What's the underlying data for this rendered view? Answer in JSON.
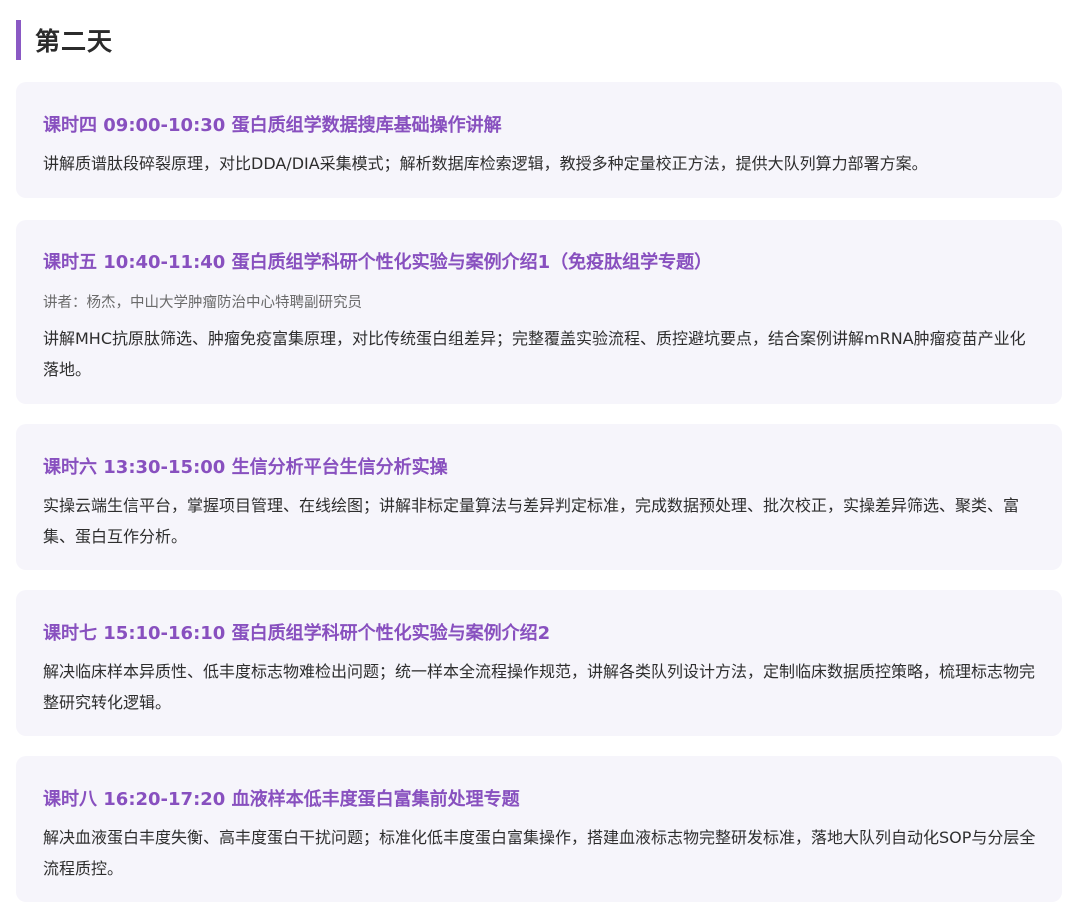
{
  "day": {
    "title": "第二天",
    "accent_color": "#8a59c4"
  },
  "sessions": [
    {
      "title": "课时四 09:00-10:30 蛋白质组学数据搜库基础操作讲解",
      "speaker": "",
      "description": "讲解质谱肽段碎裂原理，对比DDA/DIA采集模式；解析数据库检索逻辑，教授多种定量校正方法，提供大队列算力部署方案。"
    },
    {
      "title": "课时五 10:40-11:40 蛋白质组学科研个性化实验与案例介绍1（免疫肽组学专题）",
      "speaker": "讲者：杨杰，中山大学肿瘤防治中心特聘副研究员",
      "description": "讲解MHC抗原肽筛选、肿瘤免疫富集原理，对比传统蛋白组差异；完整覆盖实验流程、质控避坑要点，结合案例讲解mRNA肿瘤疫苗产业化落地。"
    },
    {
      "title": "课时六 13:30-15:00 生信分析平台生信分析实操",
      "speaker": "",
      "description": "实操云端生信平台，掌握项目管理、在线绘图；讲解非标定量算法与差异判定标准，完成数据预处理、批次校正，实操差异筛选、聚类、富集、蛋白互作分析。"
    },
    {
      "title": "课时七 15:10-16:10 蛋白质组学科研个性化实验与案例介绍2",
      "speaker": "",
      "description": "解决临床样本异质性、低丰度标志物难检出问题；统一样本全流程操作规范，讲解各类队列设计方法，定制临床数据质控策略，梳理标志物完整研究转化逻辑。"
    },
    {
      "title": "课时八 16:20-17:20 血液样本低丰度蛋白富集前处理专题",
      "speaker": "",
      "description": "解决血液蛋白丰度失衡、高丰度蛋白干扰问题；标准化低丰度蛋白富集操作，搭建血液标志物完整研发标准，落地大队列自动化SOP与分层全流程质控。"
    }
  ]
}
